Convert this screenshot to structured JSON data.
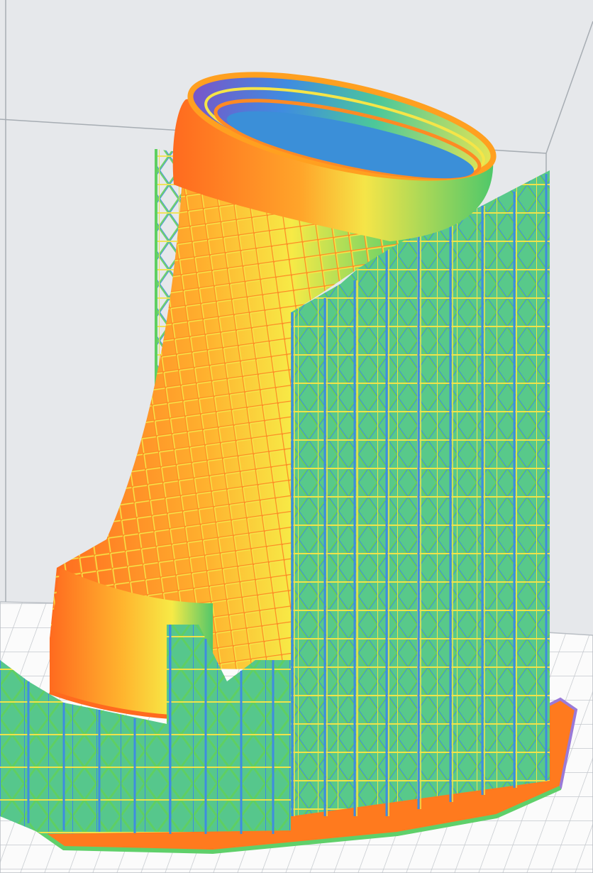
{
  "viewer": {
    "background": "#e6e8eb",
    "build_volume_line_color": "#9aa0a6",
    "bed_color": "#fbfbfb",
    "bed_grid_color": "#c2c6cb"
  },
  "model": {
    "color_scheme": [
      "#7654c8",
      "#3f8ce0",
      "#46c8b0",
      "#5bd06a",
      "#cfe84a",
      "#f5e44a",
      "#ffb02e",
      "#ff7a1e"
    ],
    "support_color": "#6fcf5c",
    "raft_color": "#ff7a1e",
    "raft_edge_color": "#9a7ad8"
  }
}
